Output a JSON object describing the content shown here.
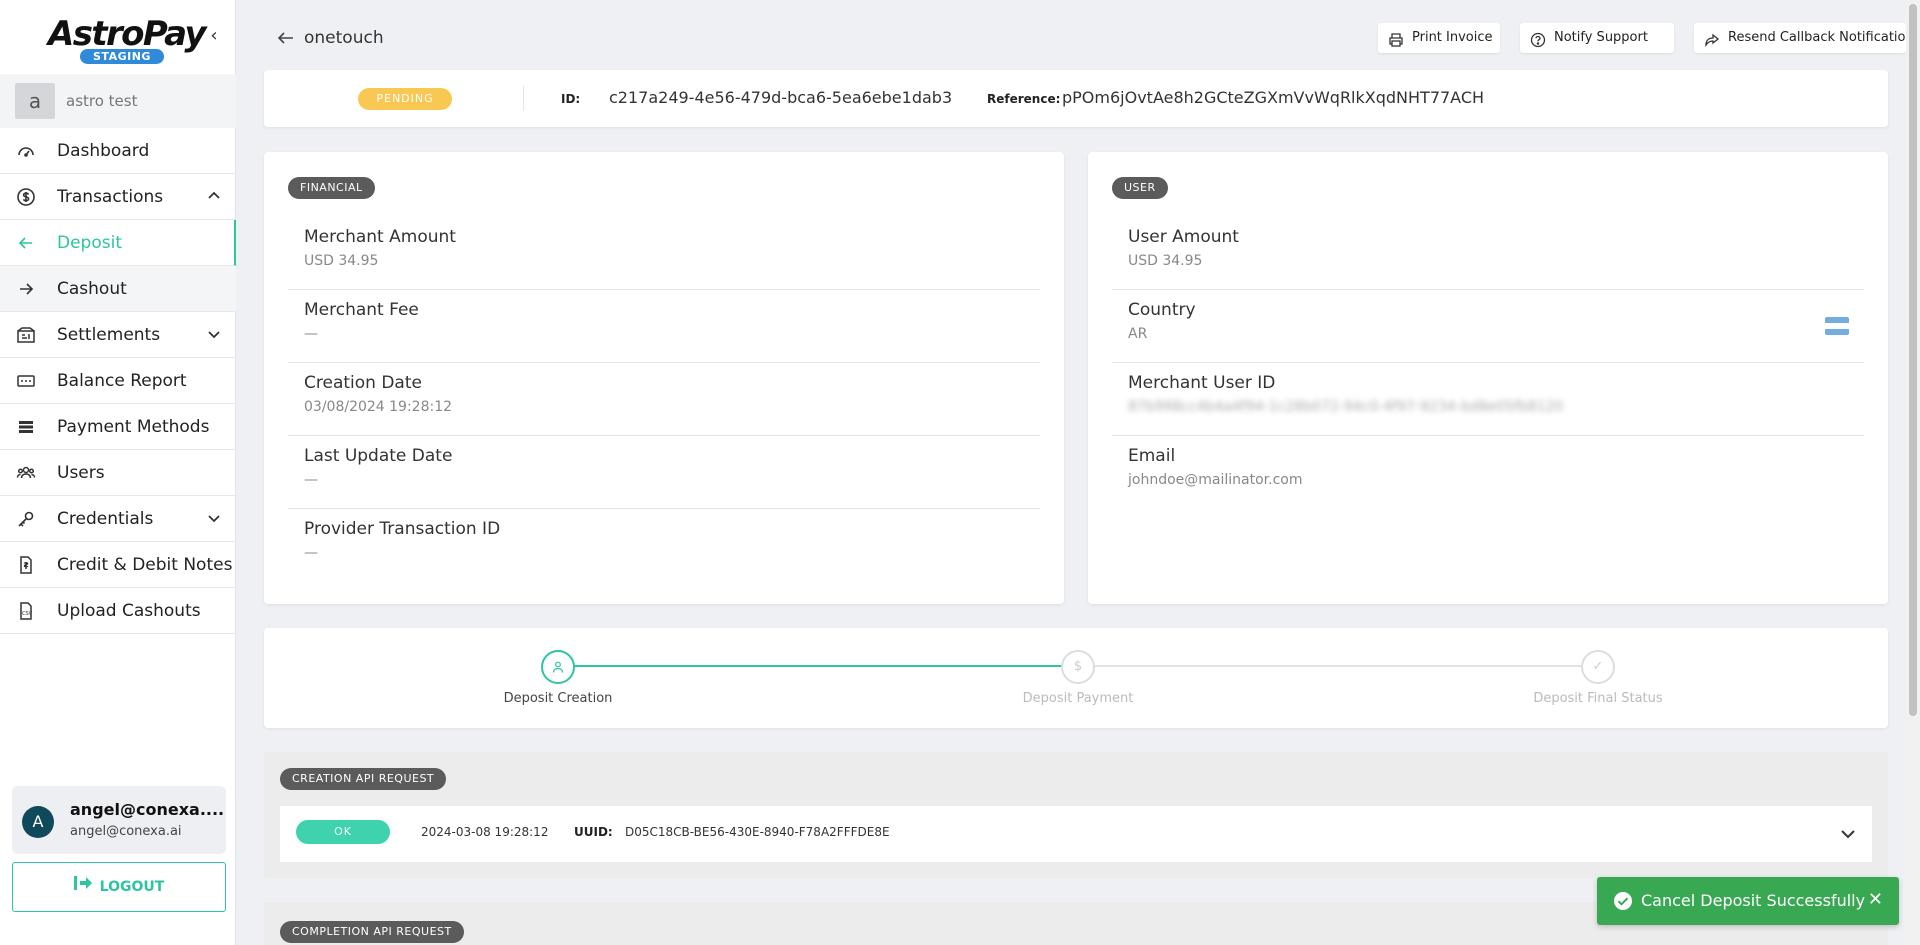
{
  "brand": {
    "name": "AstroPay",
    "env_badge": "STAGING"
  },
  "org": {
    "initial": "a",
    "name": "astro test"
  },
  "nav": [
    {
      "label": "Dashboard",
      "icon": "dashboard-icon"
    },
    {
      "label": "Transactions",
      "icon": "dollar-circle-icon",
      "chevron": "up"
    },
    {
      "label": "Deposit",
      "icon": "arrow-left-icon",
      "active": true
    },
    {
      "label": "Cashout",
      "icon": "arrow-right-icon"
    },
    {
      "label": "Settlements",
      "icon": "settlements-icon",
      "chevron": "down"
    },
    {
      "label": "Balance Report",
      "icon": "balance-icon"
    },
    {
      "label": "Payment Methods",
      "icon": "payment-methods-icon"
    },
    {
      "label": "Users",
      "icon": "users-icon"
    },
    {
      "label": "Credentials",
      "icon": "key-icon",
      "chevron": "down"
    },
    {
      "label": "Credit & Debit Notes",
      "icon": "notes-icon"
    },
    {
      "label": "Upload Cashouts",
      "icon": "csv-file-icon"
    }
  ],
  "user": {
    "initial": "A",
    "name": "angel@conexa....",
    "email": "angel@conexa.ai"
  },
  "logout_label": "LOGOUT",
  "header": {
    "title": "onetouch"
  },
  "actions": {
    "print": "Print Invoice",
    "notify": "Notify Support",
    "resend": "Resend Callback Notification"
  },
  "status": {
    "badge": "PENDING",
    "id_label": "ID:",
    "id_value": "c217a249-4e56-479d-bca6-5ea6ebe1dab3",
    "ref_label": "Reference:",
    "ref_value": "pPOm6jOvtAe8h2GCteZGXmVvWqRlkXqdNHT77ACH"
  },
  "financial": {
    "tag": "FINANCIAL",
    "fields": [
      {
        "label": "Merchant Amount",
        "value": "USD  34.95"
      },
      {
        "label": "Merchant Fee",
        "value": "—"
      },
      {
        "label": "Creation Date",
        "value": "03/08/2024 19:28:12"
      },
      {
        "label": "Last Update Date",
        "value": "—"
      },
      {
        "label": "Provider Transaction ID",
        "value": "—"
      }
    ]
  },
  "user_info": {
    "tag": "USER",
    "fields": [
      {
        "label": "User Amount",
        "value": "USD  34.95"
      },
      {
        "label": "Country",
        "value": "AR"
      },
      {
        "label": "Merchant User ID",
        "value": "87b998cc4b4a4f94-1c28b072-94c0-4f97-9234-bd8e05fb8120"
      },
      {
        "label": "Email",
        "value": "johndoe@mailinator.com"
      }
    ]
  },
  "steps": [
    {
      "label": "Deposit Creation",
      "done": true
    },
    {
      "label": "Deposit Payment",
      "done": false
    },
    {
      "label": "Deposit Final Status",
      "done": false
    }
  ],
  "creation_api": {
    "tag": "CREATION API REQUEST",
    "status": "OK",
    "date": "2024-03-08 19:28:12",
    "uuid_label": "UUID:",
    "uuid": "D05C18CB-BE56-430E-8940-F78A2FFFDE8E"
  },
  "completion_api": {
    "tag": "COMPLETION API REQUEST"
  },
  "toast": {
    "message": "Cancel Deposit Successfully",
    "close": "✕"
  },
  "colors": {
    "accent": "#2ec4a0",
    "pending": "#f9c852",
    "ok": "#3ed3ac",
    "toast": "#38a853",
    "brand_badge": "#2f8ad9"
  }
}
